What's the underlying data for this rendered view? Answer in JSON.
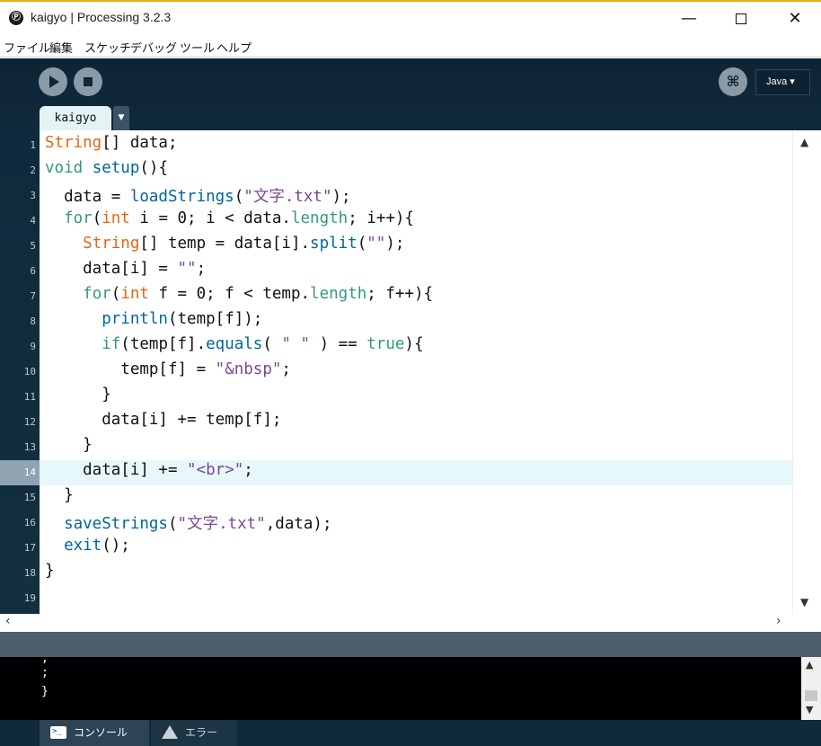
{
  "window": {
    "icon_glyph": "Ⓟ",
    "title": "kaigyo | Processing 3.2.3",
    "minimize_glyph": "—",
    "close_glyph": "✕"
  },
  "menu": [
    "ファイル",
    "編集",
    "スケッチ",
    "デバッグ",
    "ツール",
    "ヘルプ"
  ],
  "toolbar": {
    "debug_glyph": "⌘",
    "mode_label": "Java ▾",
    "tab_label": "kaigyo",
    "tab_menu_glyph": "▼"
  },
  "editor": {
    "line_numbers": [
      "1",
      "2",
      "3",
      "4",
      "5",
      "6",
      "7",
      "8",
      "9",
      "10",
      "11",
      "12",
      "13",
      "14",
      "15",
      "16",
      "17",
      "18",
      "19"
    ],
    "current_line": 14,
    "code": [
      [
        {
          "t": "String",
          "c": "or"
        },
        {
          "t": "[] data;"
        }
      ],
      [
        {
          "t": "void",
          "c": "gr"
        },
        {
          "t": " "
        },
        {
          "t": "setup",
          "c": "bl"
        },
        {
          "t": "(){"
        }
      ],
      [
        {
          "t": "  data = "
        },
        {
          "t": "loadStrings",
          "c": "bl"
        },
        {
          "t": "("
        },
        {
          "t": "\"文字.txt\"",
          "c": "pu"
        },
        {
          "t": ");"
        }
      ],
      [
        {
          "t": "  "
        },
        {
          "t": "for",
          "c": "gr"
        },
        {
          "t": "("
        },
        {
          "t": "int",
          "c": "or"
        },
        {
          "t": " i = 0; i < data."
        },
        {
          "t": "length",
          "c": "gr"
        },
        {
          "t": "; i++){"
        }
      ],
      [
        {
          "t": "    "
        },
        {
          "t": "String",
          "c": "or"
        },
        {
          "t": "[] temp = data[i]."
        },
        {
          "t": "split",
          "c": "bl"
        },
        {
          "t": "("
        },
        {
          "t": "\"\"",
          "c": "pu"
        },
        {
          "t": ");"
        }
      ],
      [
        {
          "t": "    data[i] = "
        },
        {
          "t": "\"\"",
          "c": "pu"
        },
        {
          "t": ";"
        }
      ],
      [
        {
          "t": "    "
        },
        {
          "t": "for",
          "c": "gr"
        },
        {
          "t": "("
        },
        {
          "t": "int",
          "c": "or"
        },
        {
          "t": " f = 0; f < temp."
        },
        {
          "t": "length",
          "c": "gr"
        },
        {
          "t": "; f++){"
        }
      ],
      [
        {
          "t": "      "
        },
        {
          "t": "println",
          "c": "bl"
        },
        {
          "t": "(temp[f]);"
        }
      ],
      [
        {
          "t": "      "
        },
        {
          "t": "if",
          "c": "gr"
        },
        {
          "t": "(temp[f]."
        },
        {
          "t": "equals",
          "c": "bl"
        },
        {
          "t": "( "
        },
        {
          "t": "\" \"",
          "c": "pu"
        },
        {
          "t": " ) == "
        },
        {
          "t": "true",
          "c": "gr"
        },
        {
          "t": "){"
        }
      ],
      [
        {
          "t": "        temp[f] = "
        },
        {
          "t": "\"&nbsp\"",
          "c": "pu"
        },
        {
          "t": ";"
        }
      ],
      [
        {
          "t": "      }"
        }
      ],
      [
        {
          "t": "      data[i] += temp[f];"
        }
      ],
      [
        {
          "t": "    }"
        }
      ],
      [
        {
          "t": "    data[i] += "
        },
        {
          "t": "\"<br>\"",
          "c": "pu"
        },
        {
          "t": ";"
        }
      ],
      [
        {
          "t": "  }"
        }
      ],
      [
        {
          "t": "  "
        },
        {
          "t": "saveStrings",
          "c": "bl"
        },
        {
          "t": "("
        },
        {
          "t": "\"文字.txt\"",
          "c": "pu"
        },
        {
          "t": ",data);"
        }
      ],
      [
        {
          "t": "  "
        },
        {
          "t": "exit",
          "c": "bl"
        },
        {
          "t": "();"
        }
      ],
      [
        {
          "t": "}"
        }
      ],
      []
    ]
  },
  "colors": {
    "type_keyword": "#e2661a",
    "control_keyword": "#33997e",
    "function": "#006699",
    "string": "#7d4793",
    "editor_bg": "#ffffff",
    "toolbar_bg": "#0e2434",
    "current_line_bg": "#e6f8fa"
  },
  "console": {
    "lines": [
      ";",
      ";",
      "}"
    ]
  },
  "bottom_tabs": {
    "console_label": "コンソール",
    "error_label": "エラー"
  }
}
